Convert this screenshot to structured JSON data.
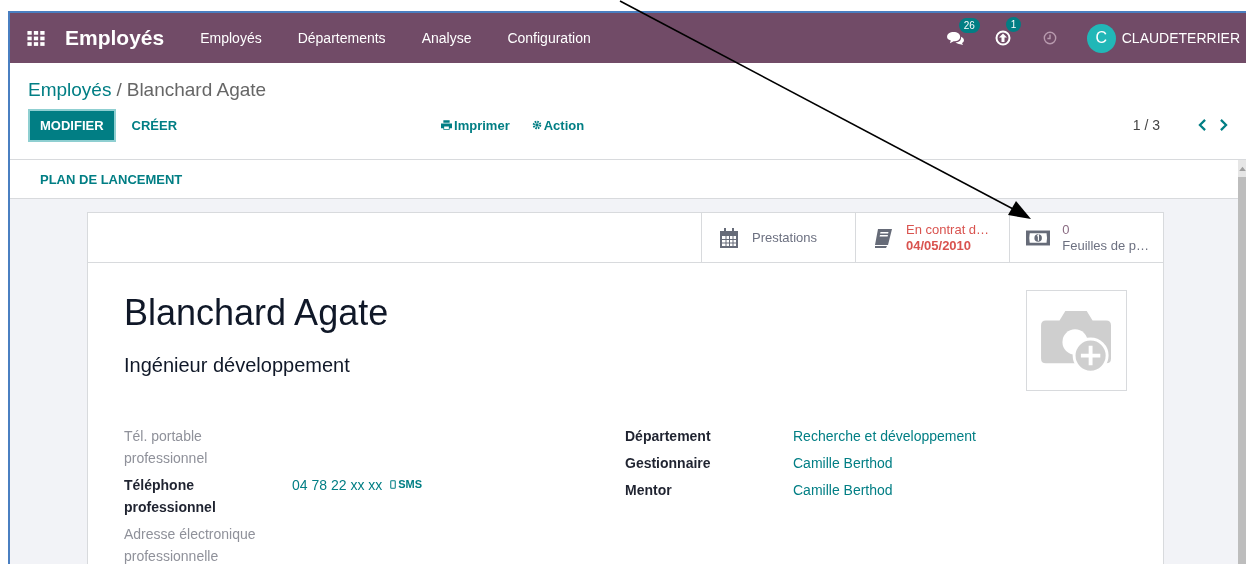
{
  "navbar": {
    "app_name": "Employés",
    "menu": [
      "Employés",
      "Départements",
      "Analyse",
      "Configuration"
    ],
    "messages_count": "26",
    "activity_count": "1",
    "user_initial": "C",
    "user_name": "CLAUDETERRIER"
  },
  "breadcrumb": {
    "parent": "Employés",
    "separator": "/",
    "current": "Blanchard Agate"
  },
  "buttons": {
    "primary": "MODIFIER",
    "secondary": "CRÉER"
  },
  "actions": [
    {
      "kind": "print",
      "label": "Imprimer"
    },
    {
      "kind": "gear",
      "label": "Action"
    }
  ],
  "pager": "1 / 3",
  "header_buttons": [
    "PLAN DE LANCEMENT"
  ],
  "smart_buttons": [
    {
      "kind": "calendar",
      "warning": false,
      "lines": [
        {
          "kind": "label",
          "text": "Prestations"
        }
      ]
    },
    {
      "kind": "book",
      "warning": true,
      "lines": [
        {
          "kind": "label",
          "text": "En contrat d…"
        },
        {
          "kind": "value",
          "text": "04/05/2010"
        }
      ]
    },
    {
      "kind": "money",
      "warning": false,
      "lines": [
        {
          "kind": "value",
          "text": "0"
        },
        {
          "kind": "label",
          "text": "Feuilles de p…"
        }
      ]
    }
  ],
  "employee": {
    "name": "Blanchard Agate",
    "job_title": "Ingénieur développement"
  },
  "left_fields": [
    {
      "label": "Tél. portable professionnel",
      "filled": false
    },
    {
      "label": "Téléphone professionnel",
      "filled": true,
      "value": "04 78 22 xx xx",
      "link": "SMS"
    },
    {
      "label": "Adresse électronique professionnelle",
      "filled": false
    }
  ],
  "right_fields": [
    {
      "label": "Département",
      "filled": true,
      "value": "Recherche et développement"
    },
    {
      "label": "Gestionnaire",
      "filled": true,
      "value": "Camille Berthod"
    },
    {
      "label": "Mentor",
      "filled": true,
      "value": "Camille Berthod"
    }
  ]
}
